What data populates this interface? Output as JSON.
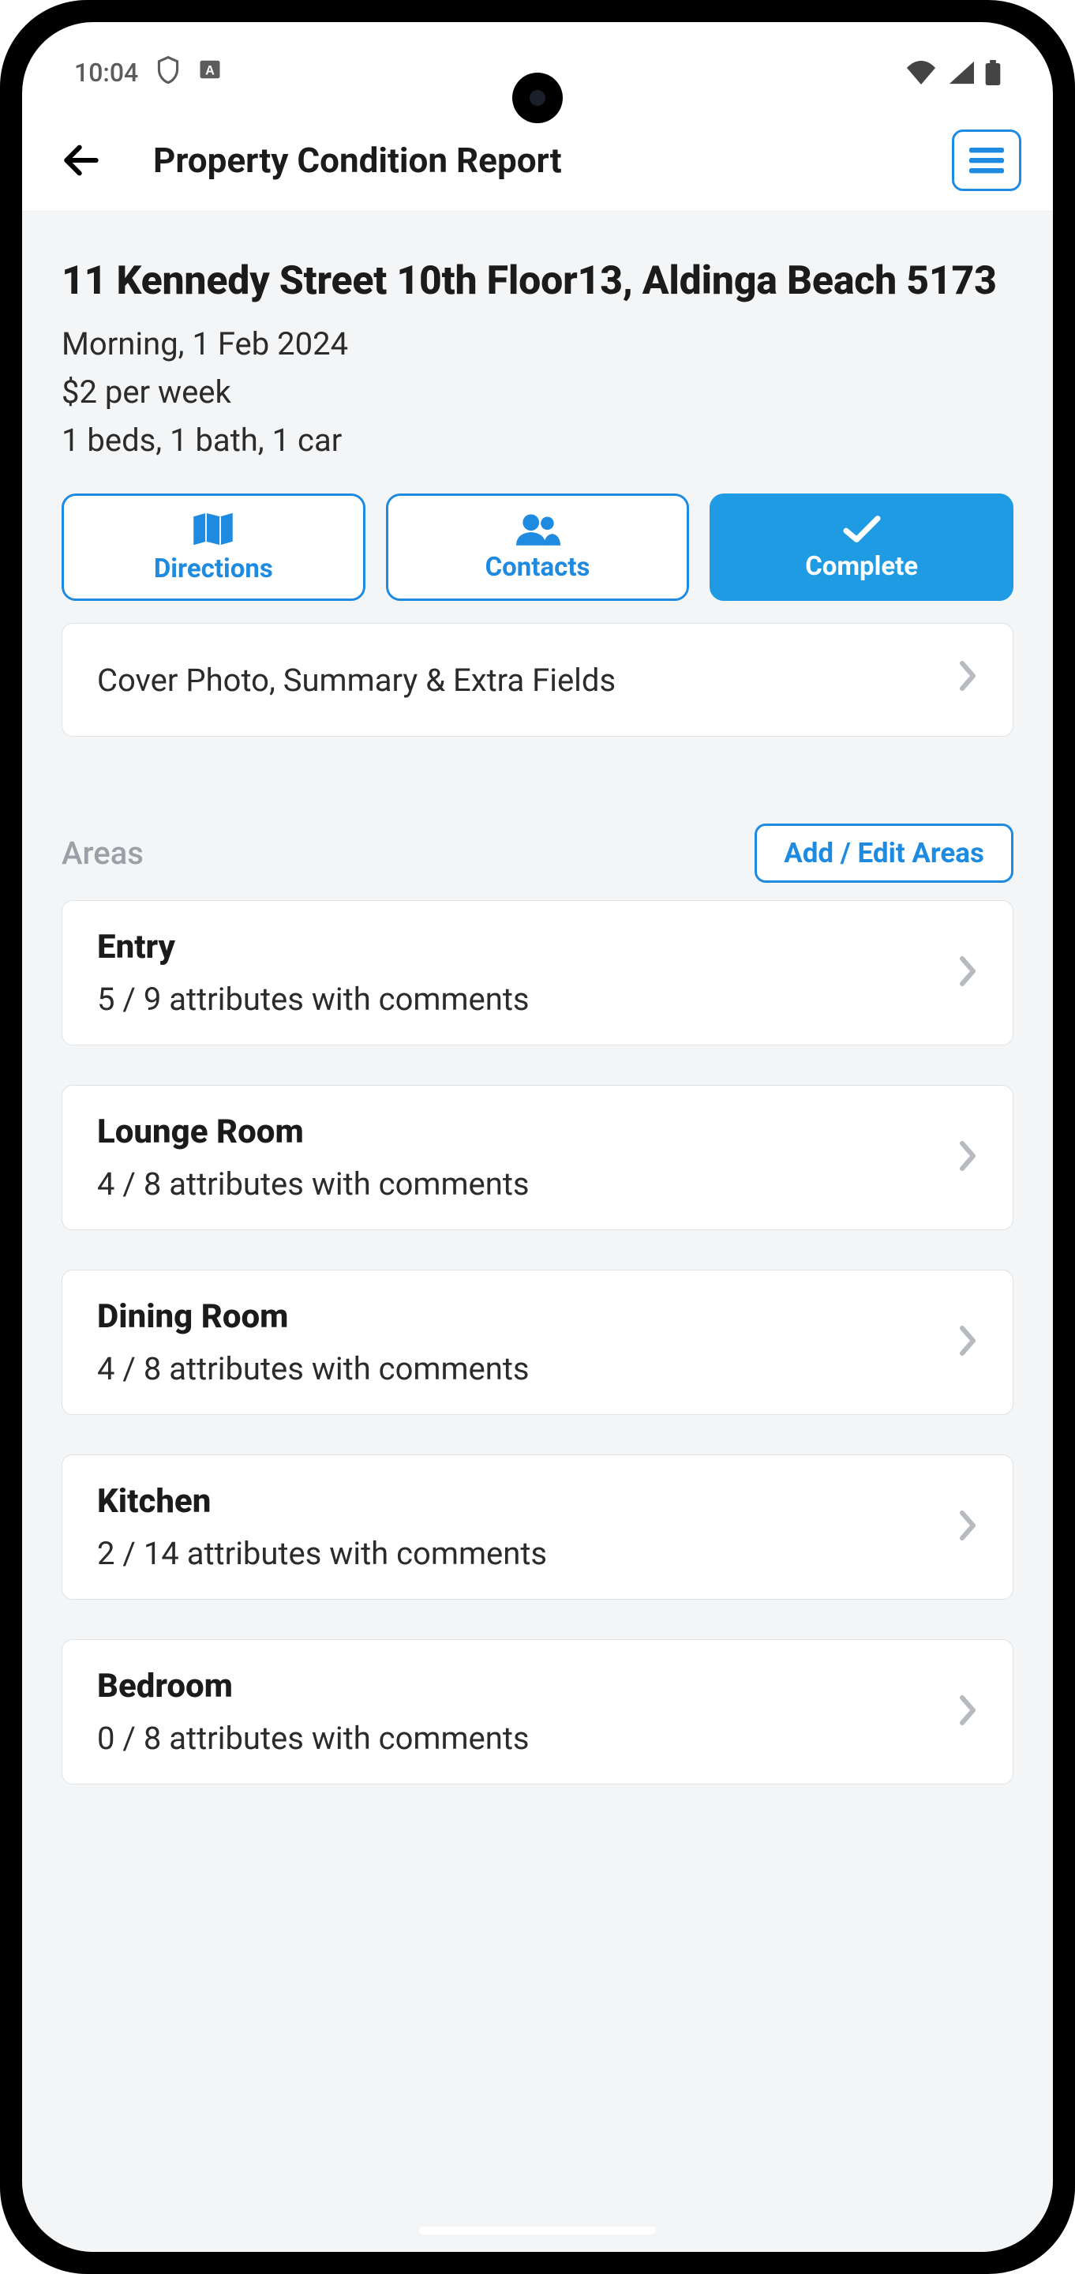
{
  "status": {
    "time": "10:04"
  },
  "header": {
    "title": "Property Condition Report"
  },
  "property": {
    "address": "11 Kennedy Street 10th Floor13, Aldinga Beach 5173",
    "schedule": "Morning, 1 Feb 2024",
    "price": "$2 per week",
    "features": "1 beds, 1 bath, 1 car"
  },
  "actions": {
    "directions": "Directions",
    "contacts": "Contacts",
    "complete": "Complete"
  },
  "cover_row": "Cover Photo, Summary & Extra Fields",
  "areas_section": {
    "label": "Areas",
    "add_edit": "Add / Edit Areas"
  },
  "areas": [
    {
      "name": "Entry",
      "sub": "5 / 9 attributes with comments"
    },
    {
      "name": "Lounge Room",
      "sub": "4 / 8 attributes with comments"
    },
    {
      "name": "Dining Room",
      "sub": "4 / 8 attributes with comments"
    },
    {
      "name": "Kitchen",
      "sub": "2 / 14 attributes with comments"
    },
    {
      "name": "Bedroom",
      "sub": "0 / 8 attributes with comments"
    }
  ]
}
